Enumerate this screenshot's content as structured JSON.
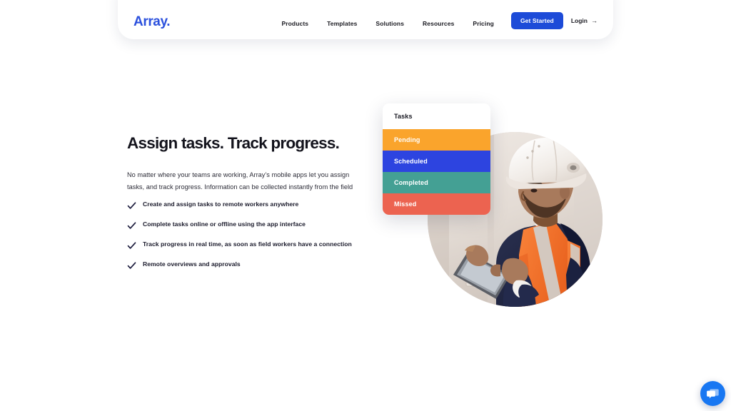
{
  "brand": {
    "name": "Array.",
    "color": "#2b50dd"
  },
  "nav": {
    "links": [
      {
        "label": "Products"
      },
      {
        "label": "Templates"
      },
      {
        "label": "Solutions"
      },
      {
        "label": "Resources"
      },
      {
        "label": "Pricing"
      }
    ],
    "cta_label": "Get Started",
    "login_label": "Login",
    "login_arrow": "→",
    "cta_color": "#1d4bd8"
  },
  "hero": {
    "title": "Assign tasks. Track progress.",
    "subtitle": "No matter where your teams are working, Array’s mobile apps let you assign tasks, and track progress. Information can be collected instantly from the field",
    "features": [
      {
        "label": "Create and assign tasks to remote workers anywhere"
      },
      {
        "label": "Complete tasks online or offline using the app interface"
      },
      {
        "label": "Track progress in real time, as soon as field workers have a connection"
      },
      {
        "label": "Remote overviews and approvals"
      }
    ],
    "check_icon": "check-icon",
    "check_color": "#1b1b3c"
  },
  "task_card": {
    "title": "Tasks",
    "rows": [
      {
        "label": "Pending",
        "color": "#faa42c"
      },
      {
        "label": "Scheduled",
        "color": "#2d44e0"
      },
      {
        "label": "Completed",
        "color": "#44a094"
      },
      {
        "label": "Missed",
        "color": "#ec6350"
      }
    ]
  },
  "photo": {
    "alt": "Field worker wearing white hard hat and orange hi-vis vest using a tablet"
  },
  "chat": {
    "icon": "chat-bubbles-icon",
    "color": "#1877f2"
  }
}
